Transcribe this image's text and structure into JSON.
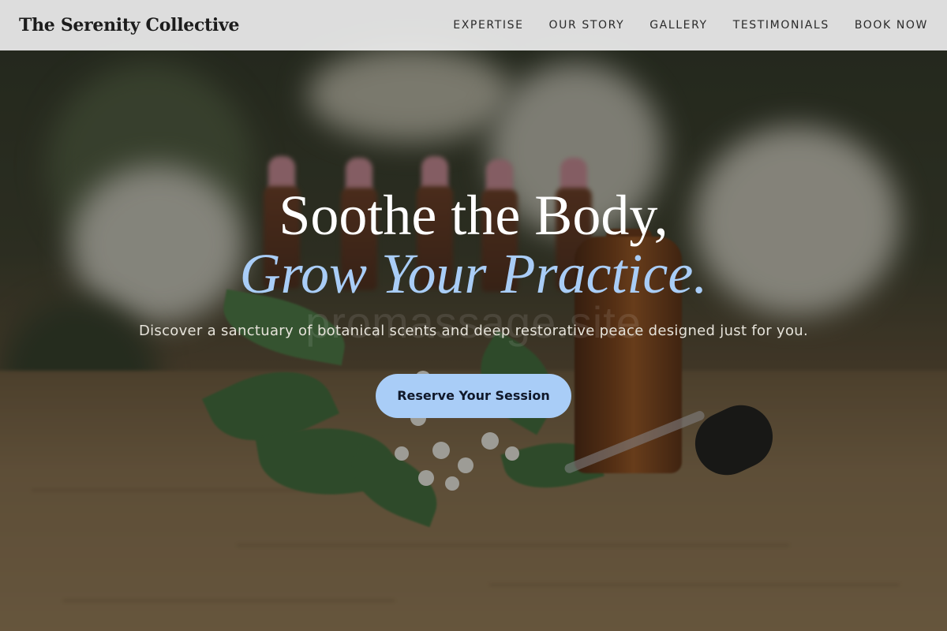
{
  "brand": {
    "name": "The Serenity Collective"
  },
  "nav": {
    "items": [
      {
        "label": "EXPERTISE"
      },
      {
        "label": "OUR STORY"
      },
      {
        "label": "GALLERY"
      },
      {
        "label": "TESTIMONIALS"
      },
      {
        "label": "BOOK NOW"
      }
    ]
  },
  "hero": {
    "headline_line1": "Soothe the Body,",
    "headline_line2": "Grow Your Practice.",
    "watermark": "promassage.site",
    "subtext": "Discover a sanctuary of botanical scents and deep restorative peace designed just for you.",
    "cta_label": "Reserve Your Session",
    "background_image": "essential-oil-bottles-with-white-flowers"
  },
  "colors": {
    "accent": "#a9cdf7",
    "header_bg": "#ececec",
    "text_dark": "#1c1c1c"
  }
}
